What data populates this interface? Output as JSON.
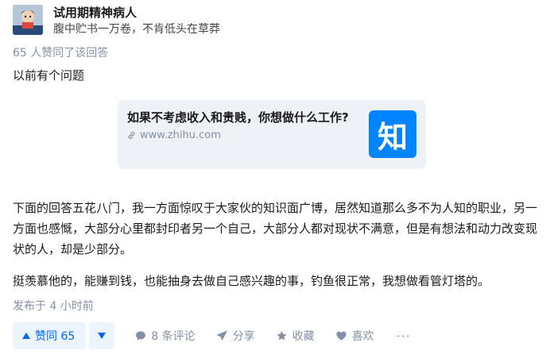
{
  "author": {
    "name": "试用期精神病人",
    "bio": "腹中贮书一万卷，不肯低头在草莽"
  },
  "votes_line": "65 人赞同了该回答",
  "content": {
    "para1": "以前有个问题",
    "link_card": {
      "title": "如果不考虑收入和贵贱，你想做什么工作?",
      "url": "www.zhihu.com",
      "logo_text": "知"
    },
    "para2": "下面的回答五花八门，我一方面惊叹于大家伙的知识面广博，居然知道那么多不为人知的职业，另一方面也感慨，大部分心里都封印者另一个自己，大部分人都对现状不满意，但是有想法和动力改变现状的人，却是少部分。",
    "para3": "挺羡慕他的，能赚到钱，也能抽身去做自己感兴趣的事，钓鱼很正常，我想做看管灯塔的。"
  },
  "published": "发布于 4 小时前",
  "actions": {
    "vote_up": "赞同 65",
    "comments": "8 条评论",
    "share": "分享",
    "collect": "收藏",
    "like": "喜欢",
    "more": "···"
  },
  "colors": {
    "accent": "#0066ff",
    "accent_bg": "#ebf4ff",
    "muted": "#8590a6",
    "zhihu_blue": "#0084ff"
  }
}
